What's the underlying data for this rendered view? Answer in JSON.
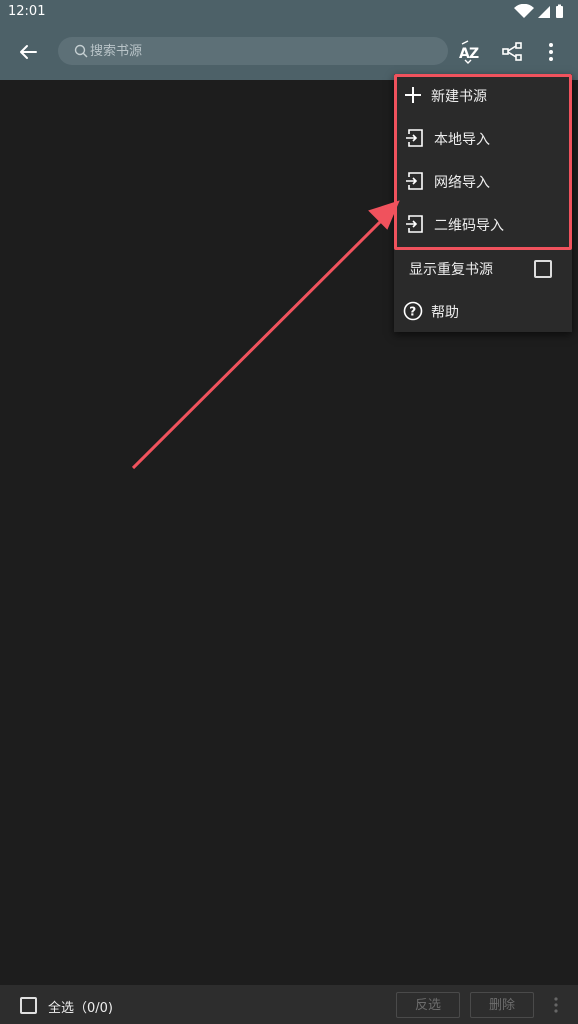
{
  "status_bar": {
    "time": "12:01",
    "icons": [
      "wifi-icon",
      "signal-icon",
      "battery-icon"
    ]
  },
  "app_bar": {
    "search_placeholder": "搜索书源",
    "icons": [
      "back-arrow-icon",
      "sort-az-icon",
      "share-nodes-icon",
      "more-vert-icon"
    ]
  },
  "menu": {
    "items": [
      {
        "label": "新建书源",
        "icon": "plus-icon"
      },
      {
        "label": "本地导入",
        "icon": "import-icon"
      },
      {
        "label": "网络导入",
        "icon": "import-icon"
      },
      {
        "label": "二维码导入",
        "icon": "import-icon"
      },
      {
        "label": "显示重复书源",
        "icon": "checkbox-icon",
        "checked": false
      },
      {
        "label": "帮助",
        "icon": "help-circle-icon"
      }
    ]
  },
  "bottom_bar": {
    "select_all_label": "全选（0/0)",
    "invert_label": "反选",
    "delete_label": "删除"
  },
  "colors": {
    "app_bar": "#4d6168",
    "background": "#1d1d1d",
    "menu_bg": "#2a2a2a",
    "annotation": "#f0525d"
  }
}
